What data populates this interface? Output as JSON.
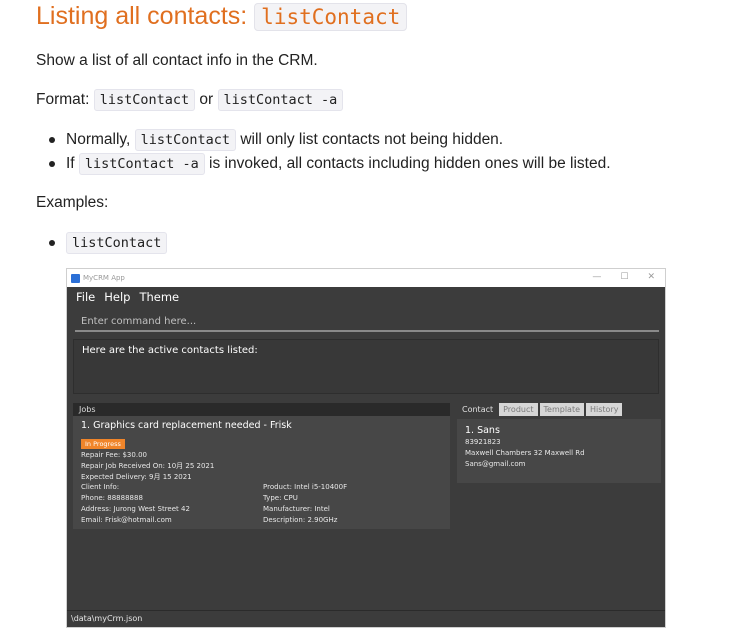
{
  "doc": {
    "title_text": "Listing all contacts: ",
    "title_code": "listContact",
    "description": "Show a list of all contact info in the CRM.",
    "format_label": "Format: ",
    "format_code1": "listContact",
    "format_or": " or ",
    "format_code2": "listContact -a",
    "bullets": [
      {
        "pre": "Normally, ",
        "code": "listContact",
        "post": " will only list contacts not being hidden."
      },
      {
        "pre": "If ",
        "code": "listContact -a",
        "post": " is invoked, all contacts including hidden ones will be listed."
      }
    ],
    "examples_label": "Examples:",
    "example_code": "listContact"
  },
  "app": {
    "window_title": "MyCRM App",
    "controls": {
      "minimize": "—",
      "maximize": "☐",
      "close": "✕"
    },
    "menu": [
      "File",
      "Help",
      "Theme"
    ],
    "command_placeholder": "Enter command here...",
    "result_text": "Here are the active contacts listed:",
    "jobs": {
      "header": "Jobs",
      "title": "1. Graphics card replacement needed - Frisk",
      "status": "In Progress",
      "fee": "Repair Fee: $30.00",
      "received": "Repair Job Received On: 10月 25 2021",
      "expected": "Expected Delivery: 9月 15 2021",
      "client_label": "Client Info:",
      "phone": "Phone: 88888888",
      "address": "Address: Jurong West Street 42",
      "email": "Email: Frisk@hotmail.com",
      "product": "Product: Intel i5-10400F",
      "type": "Type: CPU",
      "manufacturer": "Manufacturer: Intel",
      "description": "Description: 2.90GHz"
    },
    "tabs": [
      "Contact",
      "Product",
      "Template",
      "History"
    ],
    "contact": {
      "name": "1.  Sans",
      "phone": "83921823",
      "address": "Maxwell Chambers 32 Maxwell Rd",
      "email": "Sans@gmail.com"
    },
    "status_path": "\\data\\myCrm.json"
  },
  "colors": {
    "title_accent": "#e06f1f",
    "app_bg": "#3c3c3c",
    "badge": "#f0852a"
  }
}
